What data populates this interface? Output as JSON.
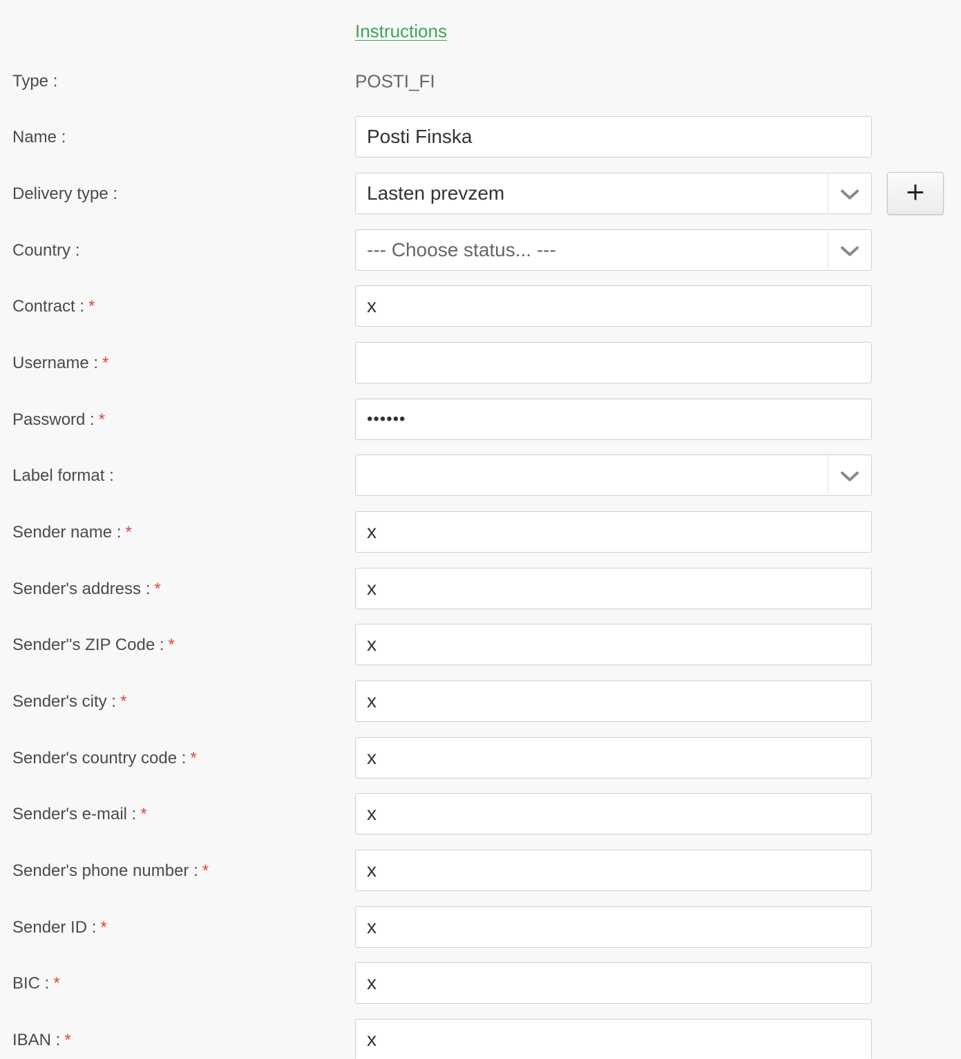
{
  "instructions_link": "Instructions",
  "fields": {
    "type": {
      "label": "Type :",
      "value": "POSTI_FI"
    },
    "name": {
      "label": "Name :",
      "value": "Posti Finska"
    },
    "delivery_type": {
      "label": "Delivery type :",
      "value": "Lasten prevzem",
      "add_button": "+"
    },
    "country": {
      "label": "Country :",
      "placeholder": "--- Choose status... ---"
    },
    "contract": {
      "label": "Contract :",
      "value": "x",
      "required": "*"
    },
    "username": {
      "label": "Username :",
      "value": "",
      "required": "*"
    },
    "password": {
      "label": "Password :",
      "value": "••••••",
      "required": "*"
    },
    "label_format": {
      "label": "Label format :",
      "value": ""
    },
    "sender_name": {
      "label": "Sender name :",
      "value": "x",
      "required": "*"
    },
    "sender_address": {
      "label": "Sender's address :",
      "value": "x",
      "required": "*"
    },
    "sender_zip": {
      "label": "Sender''s ZIP Code :",
      "value": "x",
      "required": "*"
    },
    "sender_city": {
      "label": "Sender's city :",
      "value": "x",
      "required": "*"
    },
    "sender_country_code": {
      "label": "Sender's country code :",
      "value": "x",
      "required": "*"
    },
    "sender_email": {
      "label": "Sender's e-mail :",
      "value": "x",
      "required": "*"
    },
    "sender_phone": {
      "label": "Sender's phone number :",
      "value": "x",
      "required": "*"
    },
    "sender_id": {
      "label": "Sender ID :",
      "value": "x",
      "required": "*"
    },
    "bic": {
      "label": "BIC :",
      "value": "x",
      "required": "*"
    },
    "iban": {
      "label": "IBAN :",
      "value": "x",
      "required": "*"
    }
  },
  "colors": {
    "link": "#3aa652",
    "required": "#e2453c",
    "background": "#f8f8f8"
  },
  "icons": {
    "select_arrow": "chevron-down-icon",
    "add": "plus-icon"
  }
}
